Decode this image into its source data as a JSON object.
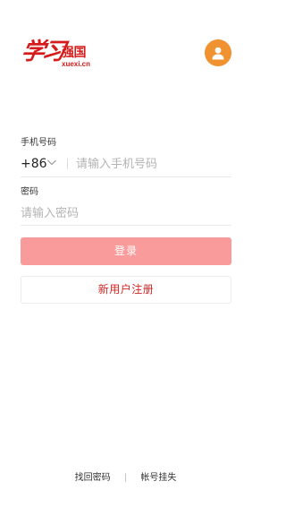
{
  "header": {
    "logo_script": "学习",
    "logo_strong": "强国",
    "logo_domain": "xuexi.cn",
    "avatar_icon": "user-icon",
    "brand_color": "#d51b1b",
    "avatar_color": "#f0922f"
  },
  "form": {
    "phone_label": "手机号码",
    "country_code": "+86",
    "phone_placeholder": "请输入手机号码",
    "phone_value": "",
    "password_label": "密码",
    "password_placeholder": "请输入密码",
    "password_value": ""
  },
  "actions": {
    "login_label": "登录",
    "login_color": "#f99b9b",
    "register_label": "新用户注册",
    "register_text_color": "#d32424"
  },
  "footer": {
    "recover_password": "找回密码",
    "separator": "|",
    "lost_account": "帐号挂失"
  }
}
